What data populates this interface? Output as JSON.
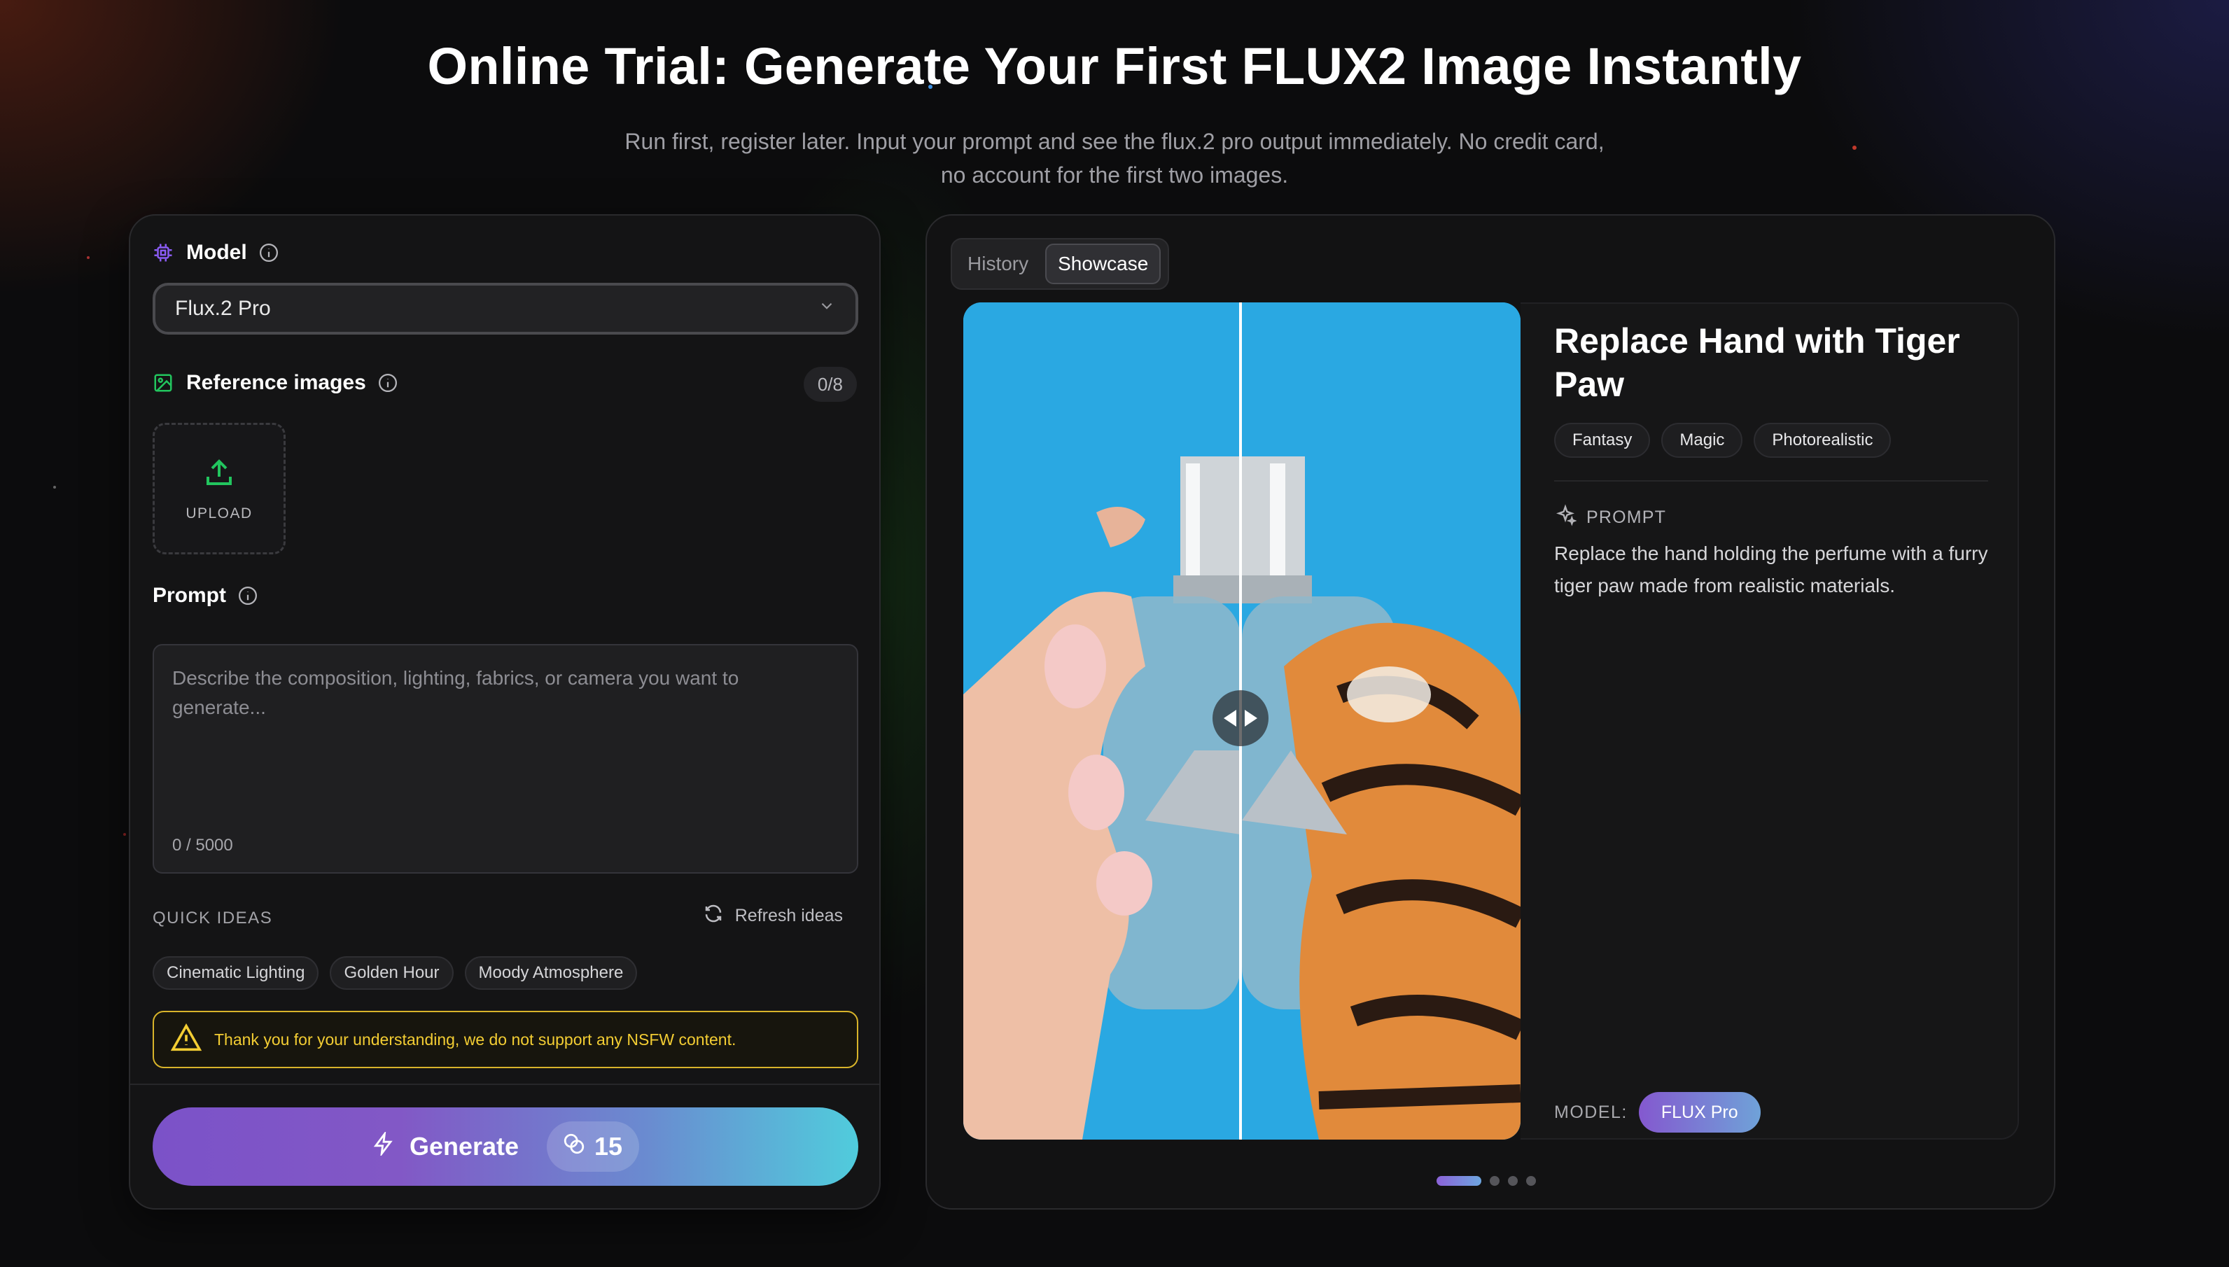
{
  "hero": {
    "title": "Online Trial: Generate Your First FLUX2 Image Instantly",
    "subtitle": "Run first, register later. Input your prompt and see the flux.2 pro output immediately. No credit card, no account for the first two images."
  },
  "form": {
    "model": {
      "label": "Model",
      "selected": "Flux.2 Pro",
      "icon": "chip-icon"
    },
    "reference": {
      "label": "Reference images",
      "count": "0/8",
      "upload_label": "UPLOAD",
      "icon": "image-icon"
    },
    "prompt": {
      "label": "Prompt",
      "placeholder": "Describe the composition, lighting, fabrics, or camera you want to generate...",
      "value": "",
      "char_count": "0 / 5000"
    },
    "quick_ideas": {
      "title": "QUICK IDEAS",
      "refresh_label": "Refresh ideas",
      "chips": [
        "Cinematic Lighting",
        "Golden Hour",
        "Moody Atmosphere"
      ]
    },
    "warning": "Thank you for your understanding, we do not support any NSFW content.",
    "generate": {
      "label": "Generate",
      "credits": "15"
    }
  },
  "showcase": {
    "tabs": [
      {
        "label": "History",
        "active": false
      },
      {
        "label": "Showcase",
        "active": true
      }
    ],
    "title": "Replace Hand with Tiger Paw",
    "tags": [
      "Fantasy",
      "Magic",
      "Photorealistic"
    ],
    "prompt_label": "PROMPT",
    "prompt_text": "Replace the hand holding the perfume with a furry tiger paw made from realistic materials.",
    "model_label": "MODEL:",
    "model_value": "FLUX Pro",
    "pager": {
      "pages": 4,
      "current": 1
    }
  },
  "colors": {
    "accent_purple": "#7b52c8",
    "accent_cyan": "#50ccdc",
    "warning": "#f3cd33",
    "panel_bg": "#141415",
    "page_bg": "#0c0c0d"
  }
}
